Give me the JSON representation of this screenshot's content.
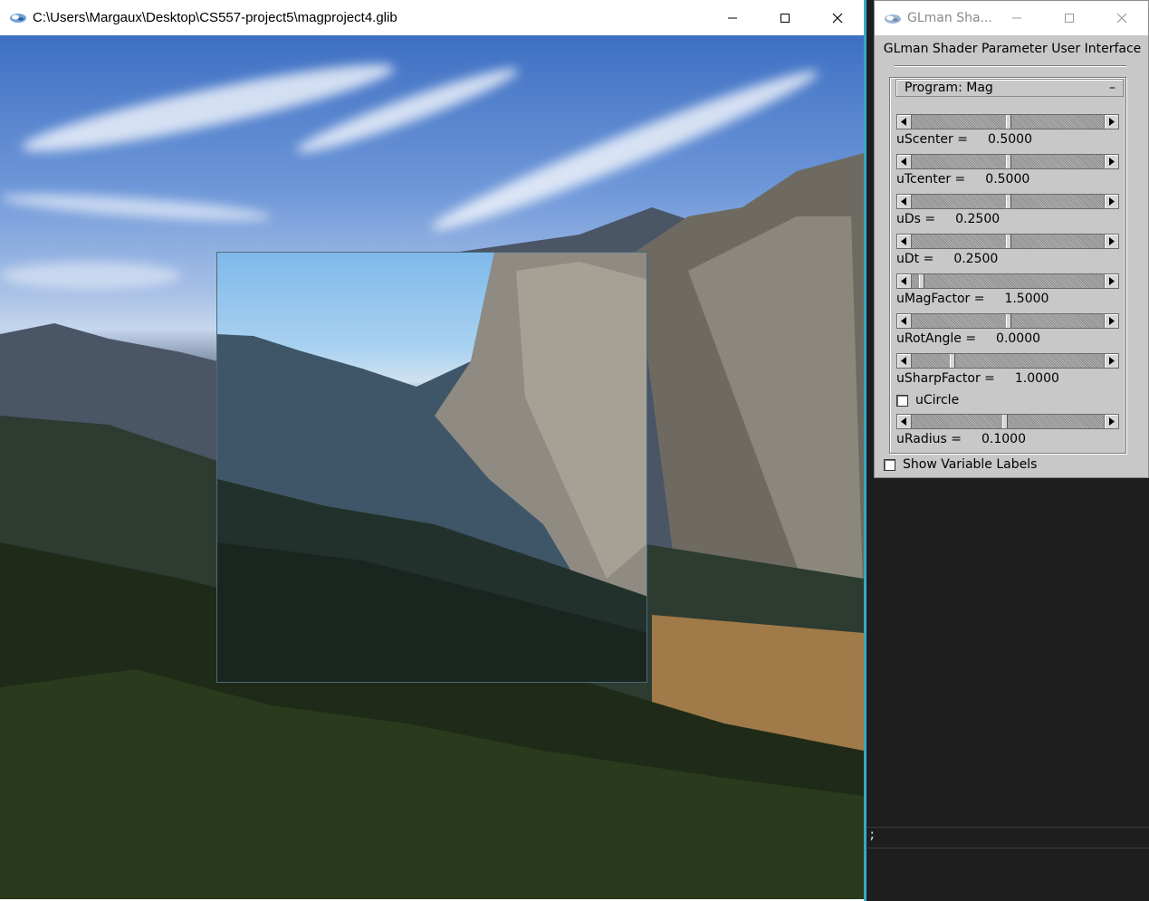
{
  "main_window": {
    "title": "C:\\Users\\Margaux\\Desktop\\CS557-project5\\magproject4.glib"
  },
  "glman_panel": {
    "window_title": "GLman Sha...",
    "heading": "GLman Shader Parameter User Interface",
    "program": {
      "label": "Program: Mag",
      "collapse_symbol": "–"
    },
    "params": [
      {
        "name": "uScenter =",
        "value": "0.5000"
      },
      {
        "name": "uTcenter =",
        "value": "0.5000"
      },
      {
        "name": "uDs =",
        "value": "0.2500"
      },
      {
        "name": "uDt =",
        "value": "0.2500"
      },
      {
        "name": "uMagFactor =",
        "value": "1.5000"
      },
      {
        "name": "uRotAngle =",
        "value": "0.0000"
      },
      {
        "name": "uSharpFactor =",
        "value": "1.0000"
      }
    ],
    "slider_levels": [
      0.5,
      0.5,
      0.5,
      0.5,
      0.04,
      0.5,
      0.2
    ],
    "checkbox_circle": {
      "label": "uCircle",
      "checked": false
    },
    "radius": {
      "name": "uRadius =",
      "value": "0.1000"
    },
    "radius_level": 0.48,
    "show_variable_labels": {
      "label": "Show Variable Labels",
      "checked": false
    }
  },
  "console": {
    "text": ";"
  },
  "colors": {
    "panel_bg": "#c8c8c8",
    "accent_border": "#3aa7c4",
    "console_bg": "#1e1e1e"
  }
}
